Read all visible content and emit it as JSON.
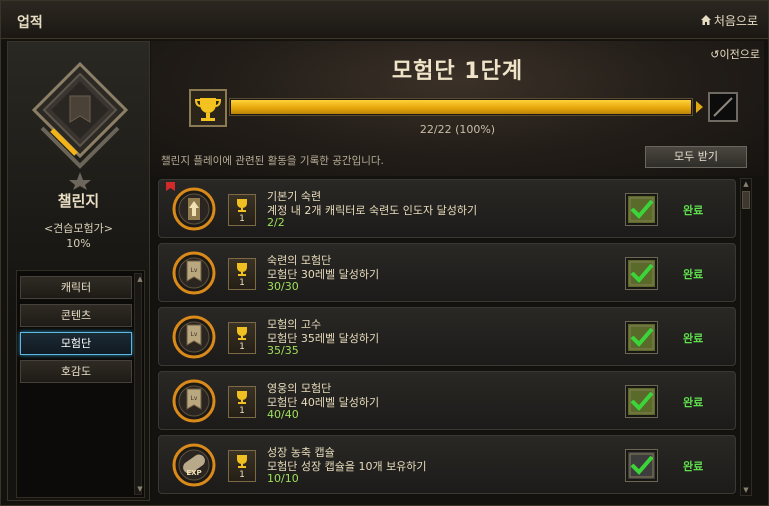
{
  "window": {
    "title": "업적",
    "home_label": "처음으로"
  },
  "left_panel": {
    "name": "챌린지",
    "rank": "<견습모험가>",
    "percent": "10%",
    "categories": [
      {
        "label": "캐릭터",
        "active": false
      },
      {
        "label": "콘텐츠",
        "active": false
      },
      {
        "label": "모험단",
        "active": true
      },
      {
        "label": "호감도",
        "active": false
      }
    ]
  },
  "header": {
    "back_label": "이전으로",
    "stage_title": "모험단 1단계",
    "progress_text": "22/22 (100%)",
    "progress": 1.0,
    "description": "챌린지 플레이에 관련된 활동을 기록한 공간입니다.",
    "claim_all_label": "모두 받기"
  },
  "achievements": [
    {
      "title": "기본기 숙련",
      "description": "계정 내 2개 캐릭터로 숙련도 인도자 달성하기",
      "progress": "2/2",
      "points": "1",
      "status": "완료",
      "badge": "level-up-icon",
      "flag": true
    },
    {
      "title": "숙련의 모험단",
      "description": "모험단 30레벨 달성하기",
      "progress": "30/30",
      "points": "1",
      "status": "완료",
      "badge": "lv30-icon",
      "flag": false
    },
    {
      "title": "모험의 고수",
      "description": "모험단 35레벨 달성하기",
      "progress": "35/35",
      "points": "1",
      "status": "완료",
      "badge": "lv35-icon",
      "flag": false
    },
    {
      "title": "영웅의 모험단",
      "description": "모험단 40레벨 달성하기",
      "progress": "40/40",
      "points": "1",
      "status": "완료",
      "badge": "lv40-icon",
      "flag": false
    },
    {
      "title": "성장 농축 캡슐",
      "description": "모험단 성장 캡슐을 10개 보유하기",
      "progress": "10/10",
      "points": "1",
      "status": "완료",
      "badge": "exp-capsule-icon",
      "flag": false
    }
  ],
  "colors": {
    "accent_gold": "#e4a408",
    "complete_green": "#5fe04a",
    "active_tab_border": "#5fb8e0"
  }
}
